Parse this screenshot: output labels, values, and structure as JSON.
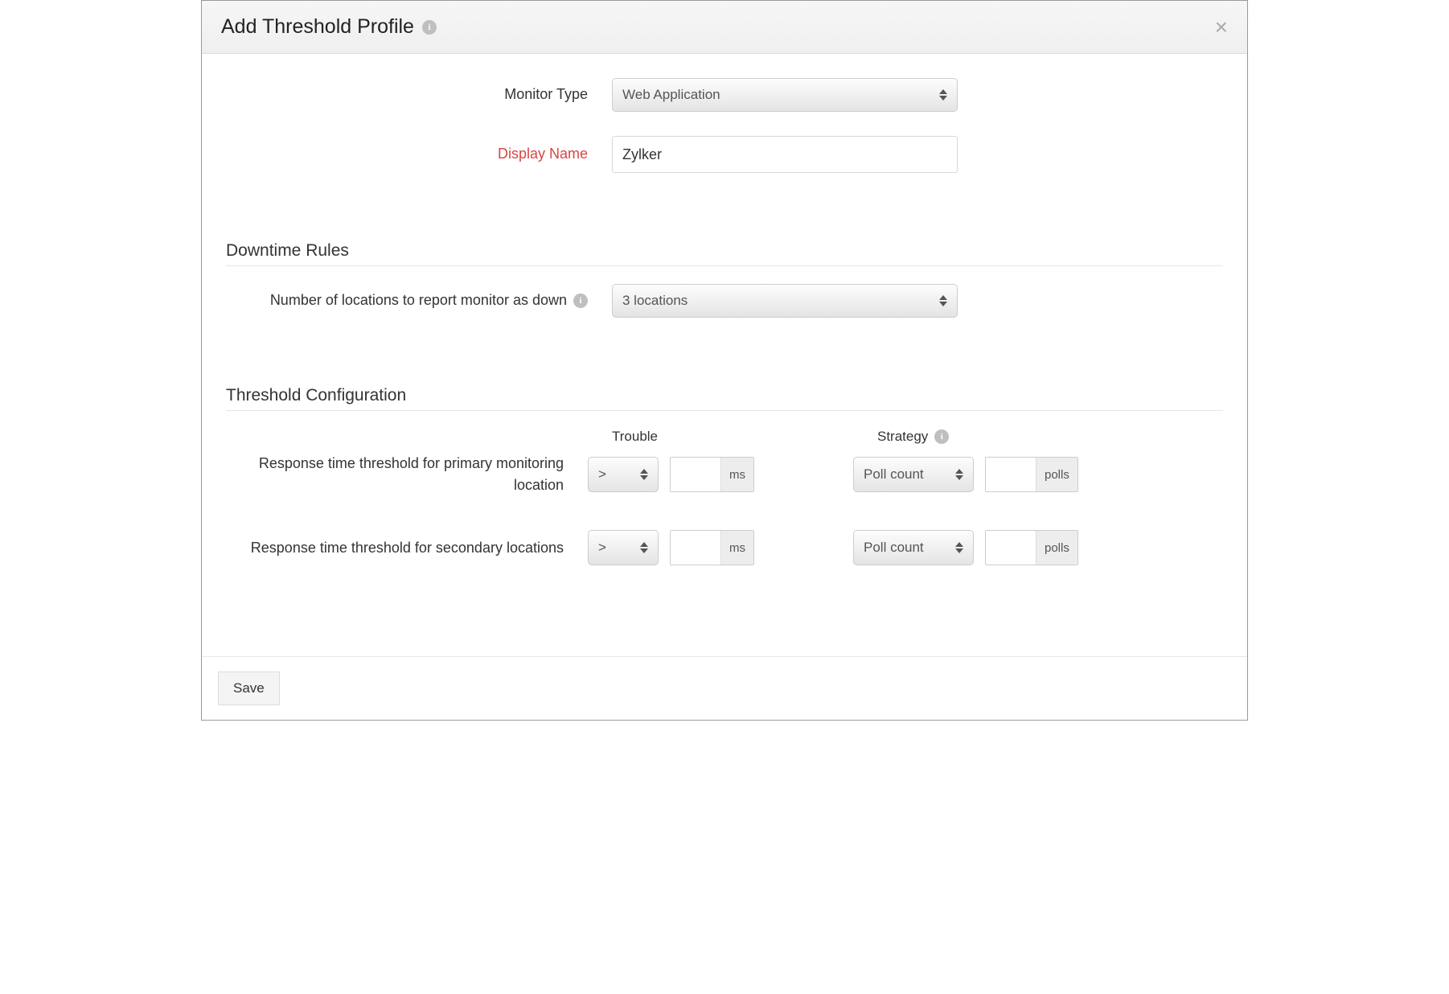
{
  "header": {
    "title": "Add Threshold Profile"
  },
  "form": {
    "monitorType": {
      "label": "Monitor Type",
      "value": "Web Application"
    },
    "displayName": {
      "label": "Display Name",
      "value": "Zylker"
    }
  },
  "sections": {
    "downtimeRules": {
      "title": "Downtime Rules",
      "numLocations": {
        "label": "Number of locations to report monitor as down",
        "value": "3 locations"
      }
    },
    "thresholdConfig": {
      "title": "Threshold Configuration",
      "columns": {
        "trouble": "Trouble",
        "strategy": "Strategy"
      },
      "primary": {
        "label": "Response time threshold for primary monitoring location",
        "operator": ">",
        "value": "",
        "unit": "ms",
        "strategy": "Poll count",
        "strategyValue": "",
        "strategyUnit": "polls"
      },
      "secondary": {
        "label": "Response time threshold for secondary locations",
        "operator": ">",
        "value": "",
        "unit": "ms",
        "strategy": "Poll count",
        "strategyValue": "",
        "strategyUnit": "polls"
      }
    }
  },
  "footer": {
    "saveLabel": "Save"
  }
}
